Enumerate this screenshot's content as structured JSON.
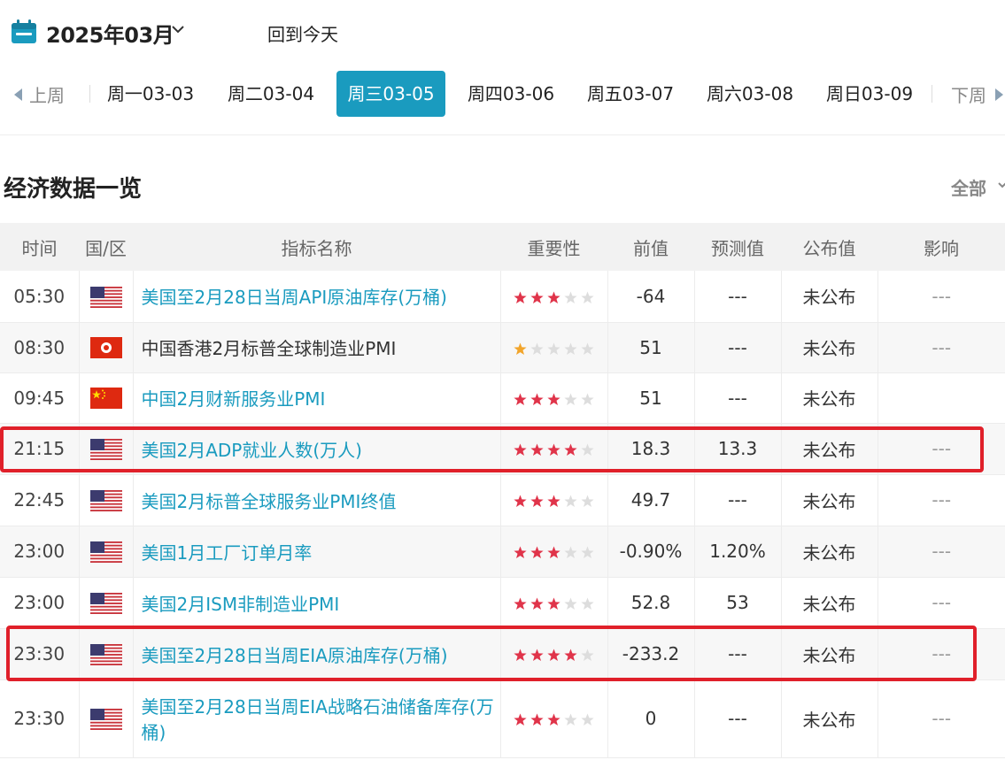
{
  "header": {
    "month": "2025年03月",
    "today_label": "回到今天"
  },
  "week": {
    "prev_label": "上周",
    "next_label": "下周",
    "days": [
      {
        "label": "周一03-03",
        "active": false
      },
      {
        "label": "周二03-04",
        "active": false
      },
      {
        "label": "周三03-05",
        "active": true
      },
      {
        "label": "周四03-06",
        "active": false
      },
      {
        "label": "周五03-07",
        "active": false
      },
      {
        "label": "周六03-08",
        "active": false
      },
      {
        "label": "周日03-09",
        "active": false
      }
    ]
  },
  "section": {
    "title": "经济数据一览",
    "filter_label": "全部"
  },
  "table": {
    "headers": [
      "时间",
      "国/区",
      "指标名称",
      "重要性",
      "前值",
      "预测值",
      "公布值",
      "影响"
    ],
    "rows": [
      {
        "time": "05:30",
        "flag": "us-flag",
        "name": "美国至2月28日当周API原油库存(万桶)",
        "stars": 3,
        "star_color": "#e0344a",
        "previous": "-64",
        "forecast": "---",
        "actual": "未公布",
        "impact": "---"
      },
      {
        "time": "08:30",
        "flag": "hk-flag",
        "name": "中国香港2月标普全球制造业PMI",
        "stars": 1,
        "star_color": "#f2a52b",
        "previous": "51",
        "forecast": "---",
        "actual": "未公布",
        "impact": "---"
      },
      {
        "time": "09:45",
        "flag": "cn-flag",
        "name": "中国2月财新服务业PMI",
        "stars": 3,
        "star_color": "#e0344a",
        "previous": "51",
        "forecast": "---",
        "actual": "未公布",
        "impact": ""
      },
      {
        "time": "21:15",
        "flag": "us-flag",
        "name": "美国2月ADP就业人数(万人)",
        "stars": 4,
        "star_color": "#e0344a",
        "previous": "18.3",
        "forecast": "13.3",
        "actual": "未公布",
        "impact": "---"
      },
      {
        "time": "22:45",
        "flag": "us-flag",
        "name": "美国2月标普全球服务业PMI终值",
        "stars": 3,
        "star_color": "#e0344a",
        "previous": "49.7",
        "forecast": "---",
        "actual": "未公布",
        "impact": "---"
      },
      {
        "time": "23:00",
        "flag": "us-flag",
        "name": "美国1月工厂订单月率",
        "stars": 3,
        "star_color": "#e0344a",
        "previous": "-0.90%",
        "forecast": "1.20%",
        "actual": "未公布",
        "impact": "---"
      },
      {
        "time": "23:00",
        "flag": "us-flag",
        "name": "美国2月ISM非制造业PMI",
        "stars": 3,
        "star_color": "#e0344a",
        "previous": "52.8",
        "forecast": "53",
        "actual": "未公布",
        "impact": "---"
      },
      {
        "time": "23:30",
        "flag": "us-flag",
        "name": "美国至2月28日当周EIA原油库存(万桶)",
        "stars": 4,
        "star_color": "#e0344a",
        "previous": "-233.2",
        "forecast": "---",
        "actual": "未公布",
        "impact": "---"
      },
      {
        "time": "23:30",
        "flag": "us-flag",
        "name": "美国至2月28日当周EIA战略石油储备库存(万桶)",
        "stars": 3,
        "star_color": "#e0344a",
        "previous": "0",
        "forecast": "---",
        "actual": "未公布",
        "impact": "---"
      }
    ]
  },
  "colors": {
    "accent": "#1a9bbf",
    "highlight_box": "#e0202a",
    "star_empty": "#dddddd"
  }
}
